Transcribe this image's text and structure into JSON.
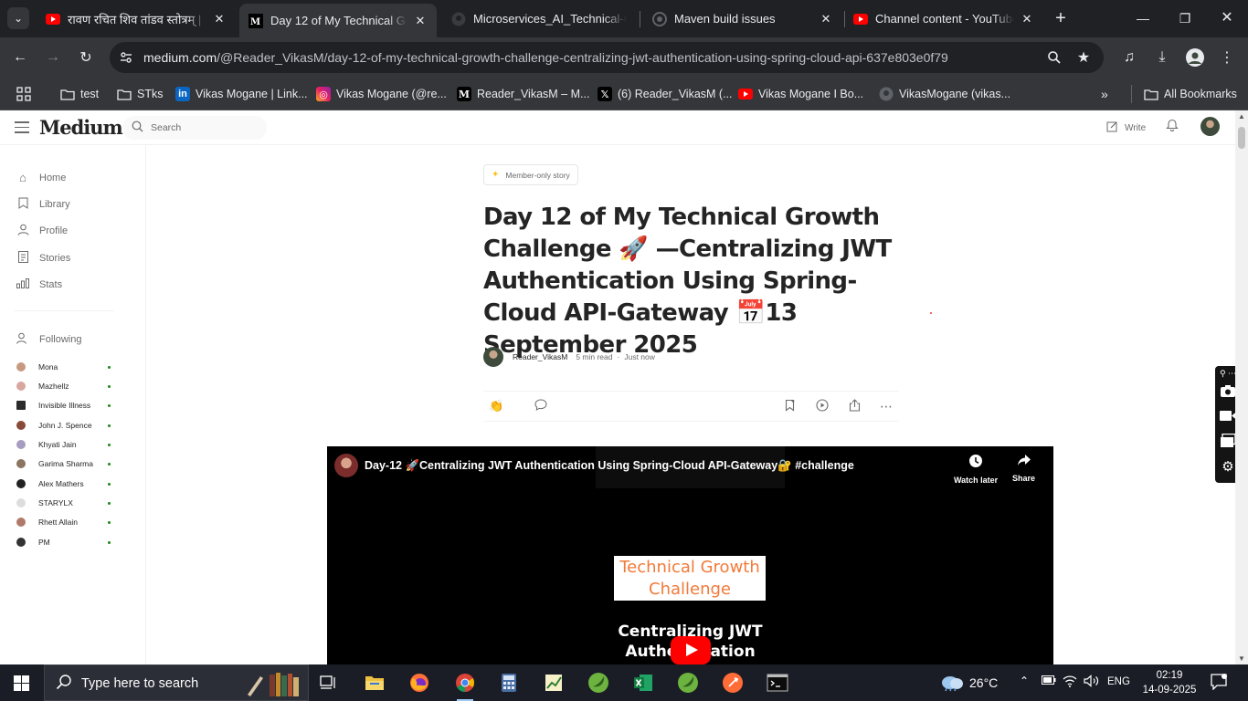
{
  "browser": {
    "tabs": [
      {
        "title": "रावण रचित शिव तांडव स्तोत्रम् | S",
        "icon": "youtube-icon",
        "active": false
      },
      {
        "title": "Day 12 of My Technical Grow",
        "icon": "medium-icon",
        "active": true
      },
      {
        "title": "Microservices_AI_Technical-C",
        "icon": "github-icon",
        "active": false
      },
      {
        "title": "Maven build issues",
        "icon": "chatgpt-icon",
        "active": false
      },
      {
        "title": "Channel content - YouTube S",
        "icon": "youtube-icon",
        "active": false
      }
    ],
    "url_host": "medium.com",
    "url_path": "/@Reader_VikasM/day-12-of-my-technical-growth-challenge-centralizing-jwt-authentication-using-spring-cloud-api-637e803e0f79",
    "bookmarks": [
      {
        "label": "test",
        "icon": "folder-icon"
      },
      {
        "label": "STks",
        "icon": "folder-icon"
      },
      {
        "label": "Vikas Mogane | Link...",
        "icon": "linkedin-icon"
      },
      {
        "label": "Vikas Mogane (@re...",
        "icon": "instagram-icon"
      },
      {
        "label": "Reader_VikasM – M...",
        "icon": "medium-icon"
      },
      {
        "label": "(6) Reader_VikasM (...",
        "icon": "x-icon"
      },
      {
        "label": "Vikas Mogane I Bo...",
        "icon": "youtube-icon"
      },
      {
        "label": "VikasMogane (vikas...",
        "icon": "github-icon"
      }
    ],
    "all_bookmarks": "All Bookmarks"
  },
  "medium": {
    "logo": "Medium",
    "search_placeholder": "Search",
    "write_label": "Write",
    "nav": [
      "Home",
      "Library",
      "Profile",
      "Stories",
      "Stats"
    ],
    "following_label": "Following",
    "following": [
      {
        "name": "Mona",
        "color": "#c79a80"
      },
      {
        "name": "Mazhellz",
        "color": "#d9a7a0"
      },
      {
        "name": "Invisible Illness",
        "color": "#2b2b2b"
      },
      {
        "name": "John J. Spence",
        "color": "#8a4a3a"
      },
      {
        "name": "Khyati Jain",
        "color": "#a89cc0"
      },
      {
        "name": "Garima Sharma",
        "color": "#8c7560"
      },
      {
        "name": "Alex Mathers",
        "color": "#222222"
      },
      {
        "name": "STARYLX",
        "color": "#dddddd"
      },
      {
        "name": "Rhett Allain",
        "color": "#b07a6a"
      },
      {
        "name": "PM",
        "color": "#333333"
      }
    ]
  },
  "article": {
    "badge": "Member-only story",
    "title": "Day 12 of My Technical Growth Challenge 🚀 —Centralizing JWT Authentication Using Spring-Cloud API-Gateway 📅13 September 2025",
    "author": "Reader_VikasM",
    "read_time": "5 min read",
    "separator": "·",
    "published": "Just now"
  },
  "video": {
    "title": "Day-12 🚀Centralizing JWT Authentication Using Spring-Cloud API-Gateway🔐 #challenge",
    "watch_later": "Watch later",
    "share": "Share",
    "card_line1": "Technical Growth",
    "card_line2": "Challenge",
    "subtitle_line1": "Centralizing JWT",
    "subtitle_line2": "Authentication"
  },
  "taskbar": {
    "search_placeholder": "Type here to search",
    "weather": "26°C",
    "language": "ENG",
    "time": "02:19",
    "date": "14-09-2025"
  },
  "colors": {
    "medium_green": "#1a8917",
    "youtube_red": "#ff0000",
    "card_orange": "#f27a3a"
  }
}
